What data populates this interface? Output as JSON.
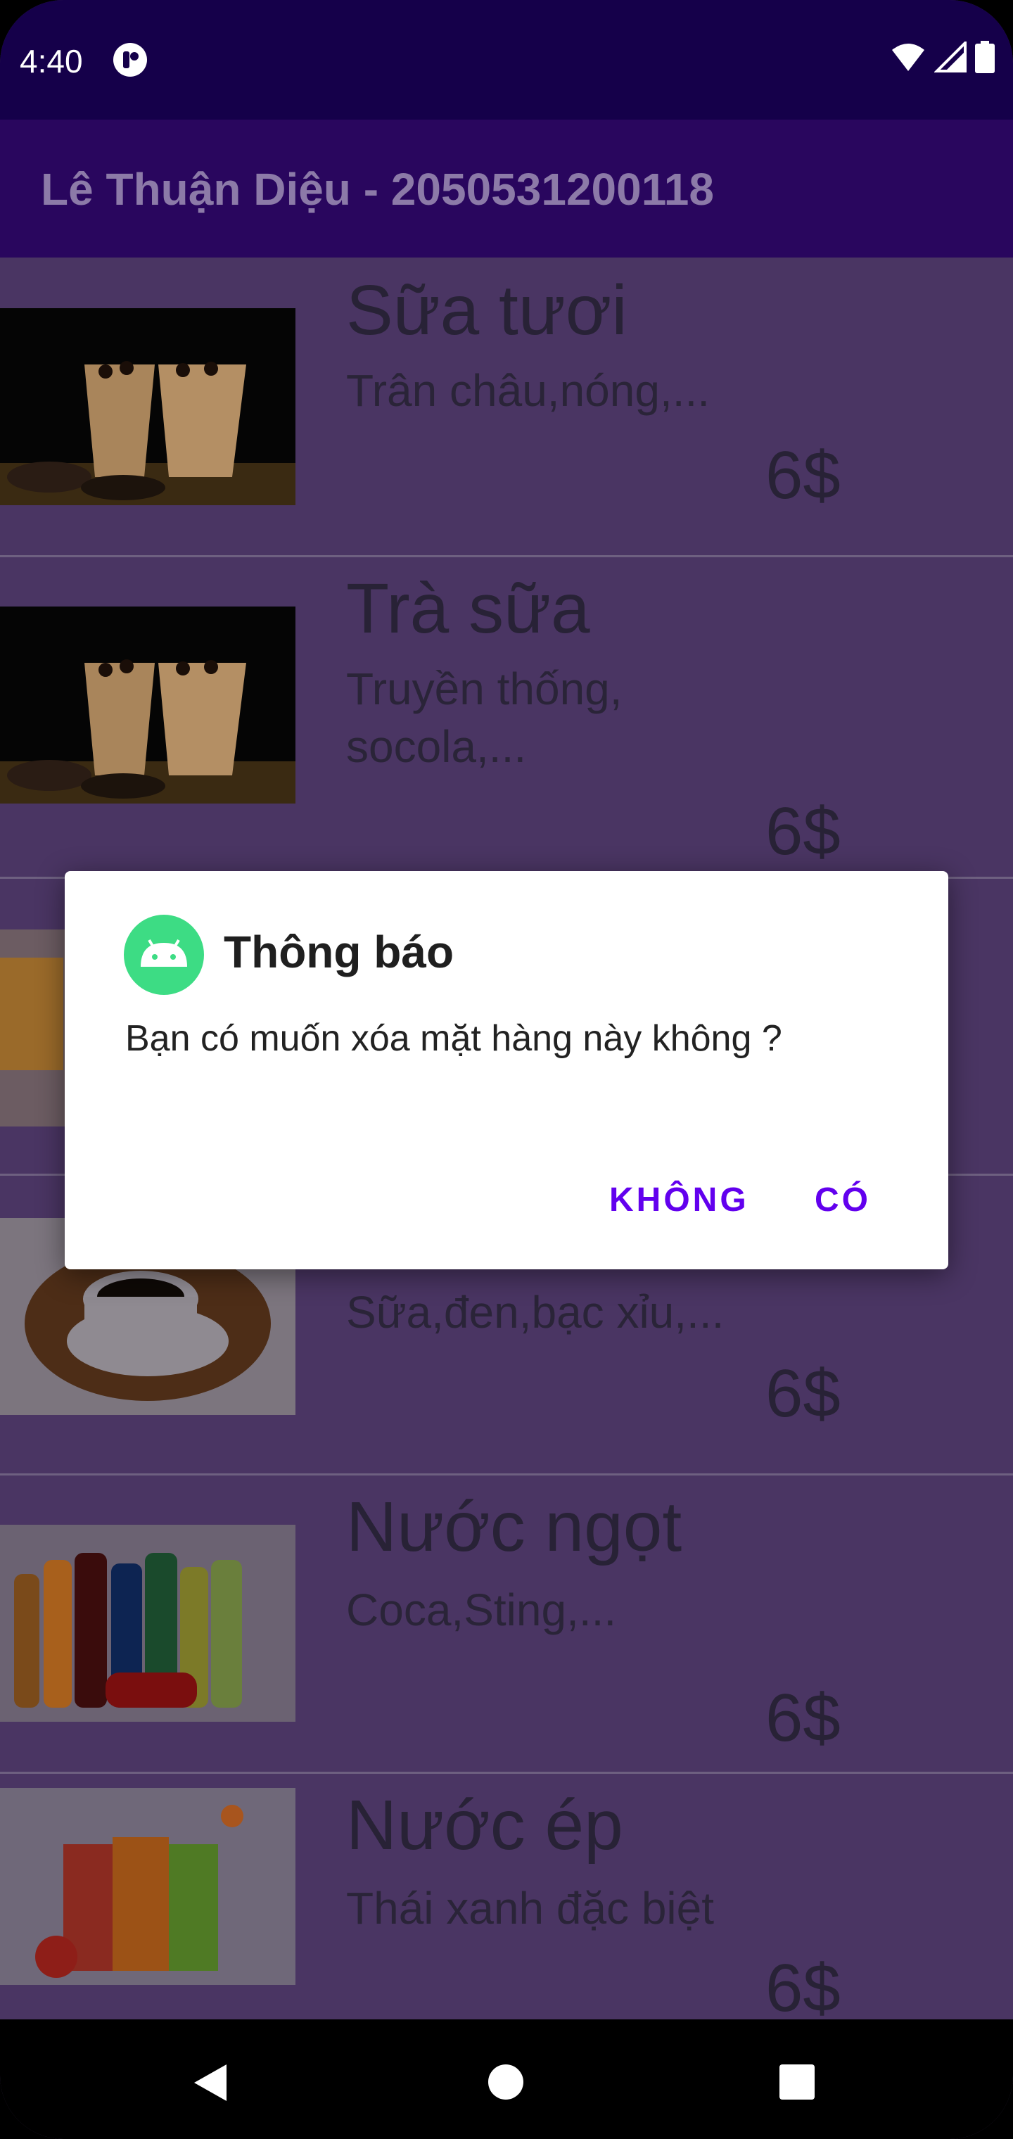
{
  "status_bar": {
    "time": "4:40",
    "icons": [
      "app-notification-icon",
      "wifi-icon",
      "signal-icon",
      "battery-icon"
    ]
  },
  "app_bar": {
    "title": "Lê Thuận Diệu - 2050531200118"
  },
  "items": [
    {
      "name": "Sữa tươi",
      "desc": "Trân châu,nóng,...",
      "price": "6$",
      "image": "milk-tea-cups-image"
    },
    {
      "name": "Trà sữa",
      "desc": "Truyền thống, socola,...",
      "price": "6$",
      "image": "milk-tea-cups-image"
    },
    {
      "name": "",
      "desc": "",
      "price": "",
      "image": "orange-drink-image"
    },
    {
      "name": "",
      "desc": "Sữa,đen,bạc xỉu,...",
      "price": "6$",
      "image": "coffee-cup-image"
    },
    {
      "name": "Nước ngọt",
      "desc": "Coca,Sting,...",
      "price": "6$",
      "image": "soda-bottles-image"
    },
    {
      "name": "Nước ép",
      "desc": "Thái xanh đặc biệt",
      "price": "6$",
      "image": "juice-glasses-image"
    }
  ],
  "dialog": {
    "icon": "android-icon",
    "title": "Thông báo",
    "message": "Bạn có muốn xóa mặt hàng này không ?",
    "negative_label": "KHÔNG",
    "positive_label": "CÓ"
  },
  "nav_bar": {
    "icons": [
      "back-icon",
      "home-icon",
      "recents-icon"
    ]
  },
  "colors": {
    "status_bar": "#15004a",
    "app_bar": "#29065e",
    "list_bg_dimmed": "#4a3563",
    "dialog_button": "#6200ee"
  }
}
